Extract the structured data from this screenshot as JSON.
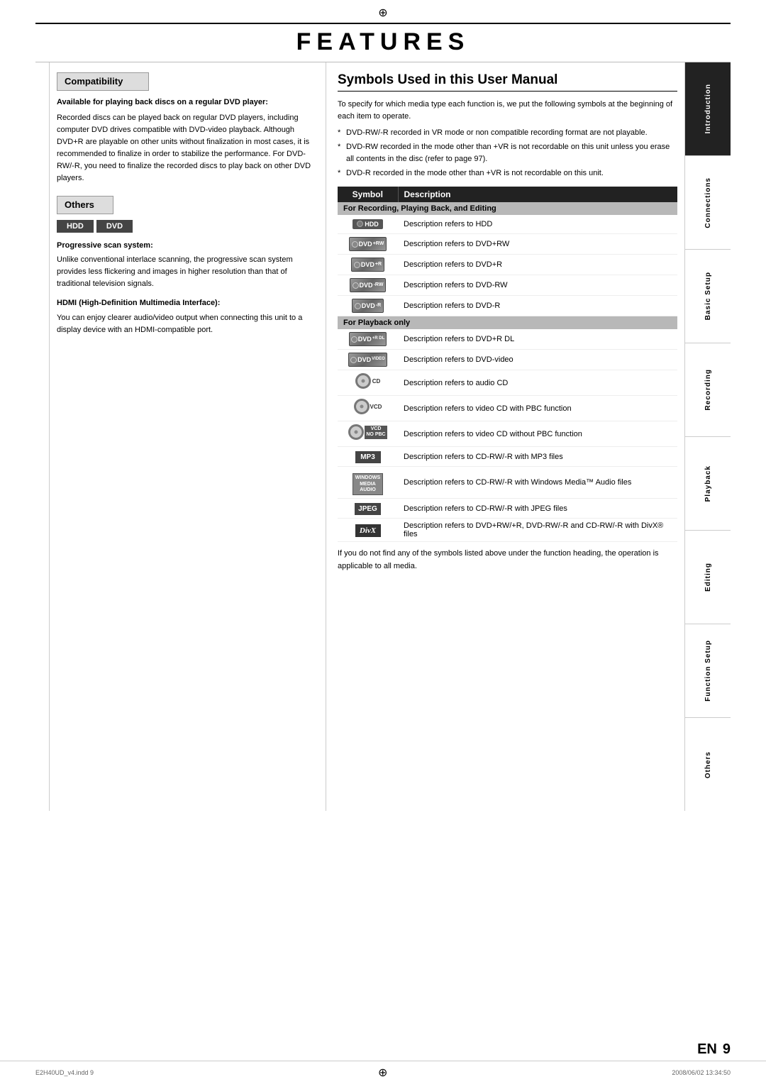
{
  "page": {
    "title": "FEATURES",
    "reg_mark_char": "⊕",
    "footer_file": "E2H40UD_v4.indd  9",
    "footer_date": "2008/06/02  13:34:50",
    "page_number": "9",
    "en_label": "EN"
  },
  "sidebar": {
    "sections": [
      {
        "label": "Introduction",
        "active": true
      },
      {
        "label": "Connections",
        "active": false
      },
      {
        "label": "Basic Setup",
        "active": false
      },
      {
        "label": "Recording",
        "active": false
      },
      {
        "label": "Playback",
        "active": false
      },
      {
        "label": "Editing",
        "active": false
      },
      {
        "label": "Function Setup",
        "active": false
      },
      {
        "label": "Others",
        "active": false
      }
    ]
  },
  "left_column": {
    "compatibility": {
      "header": "Compatibility",
      "available_heading": "Available for playing back discs on a regular DVD player:",
      "available_text": "Recorded discs can be played back on regular DVD players, including computer DVD drives compatible with DVD-video playback. Although DVD+R are playable on other units without finalization in most cases, it is recommended to finalize in order to stabilize the performance. For DVD-RW/-R, you need to finalize the recorded discs to play back on other DVD players."
    },
    "others": {
      "header": "Others",
      "hdd_badge": "HDD",
      "dvd_badge": "DVD",
      "progressive_heading": "Progressive scan system:",
      "progressive_text": "Unlike conventional interlace scanning, the progressive scan system provides less flickering and images in higher resolution than that of traditional television signals.",
      "hdmi_heading": "HDMI (High-Definition Multimedia Interface):",
      "hdmi_text": "You can enjoy clearer audio/video output when connecting this unit to a display device with an HDMI-compatible port."
    }
  },
  "right_column": {
    "section_title": "Symbols Used in this User Manual",
    "intro_text": "To specify for which media type each function is, we put the following symbols at the beginning of each item to operate.",
    "bullets": [
      "DVD-RW/-R recorded in VR mode or non compatible recording format are not playable.",
      "DVD-RW recorded in the mode other than +VR is not recordable on this unit unless you erase all contents in the disc (refer to page 97).",
      "DVD-R recorded in the mode other than +VR is not recordable on this unit."
    ],
    "table": {
      "col_symbol": "Symbol",
      "col_description": "Description",
      "recording_section": "For Recording, Playing Back, and Editing",
      "playback_section": "For Playback only",
      "rows_recording": [
        {
          "symbol_type": "hdd",
          "symbol_text": "HDD",
          "description": "Description refers to HDD"
        },
        {
          "symbol_type": "dvd",
          "symbol_text": "DVD+RW",
          "symbol_sub": "+RW",
          "description": "Description refers to DVD+RW"
        },
        {
          "symbol_type": "dvd",
          "symbol_text": "DVD+R",
          "symbol_sub": "+R",
          "description": "Description refers to DVD+R"
        },
        {
          "symbol_type": "dvd",
          "symbol_text": "DVD-RW",
          "symbol_sub": "-RW",
          "description": "Description refers to DVD-RW"
        },
        {
          "symbol_type": "dvd",
          "symbol_text": "DVD-R",
          "symbol_sub": "-R",
          "description": "Description refers to DVD-R"
        }
      ],
      "rows_playback": [
        {
          "symbol_type": "dvd",
          "symbol_text": "DVD+R DL",
          "symbol_sub": "+R DL",
          "description": "Description refers to DVD+R DL"
        },
        {
          "symbol_type": "dvd",
          "symbol_text": "DVD-video",
          "symbol_sub": "VIDEO",
          "description": "Description refers to DVD-video"
        },
        {
          "symbol_type": "cd",
          "symbol_text": "CD",
          "description": "Description refers to audio CD"
        },
        {
          "symbol_type": "vcd",
          "symbol_text": "VCD",
          "description": "Description refers to video CD with PBC function"
        },
        {
          "symbol_type": "vcd2",
          "symbol_text": "VCD",
          "description": "Description refers to video CD without PBC function"
        },
        {
          "symbol_type": "mp3",
          "symbol_text": "MP3",
          "description": "Description refers to CD-RW/-R with MP3 files"
        },
        {
          "symbol_type": "wma",
          "symbol_text": "WMA",
          "description": "Description refers to CD-RW/-R with Windows Media™ Audio files"
        },
        {
          "symbol_type": "jpeg",
          "symbol_text": "JPEG",
          "description": "Description refers to CD-RW/-R with JPEG files"
        },
        {
          "symbol_type": "divx",
          "symbol_text": "DivX",
          "description": "Description refers to DVD+RW/+R, DVD-RW/-R and CD-RW/-R with DivX® files"
        }
      ]
    },
    "bottom_note": "If you do not find any of the symbols listed above under the function heading, the operation is applicable to all media."
  }
}
